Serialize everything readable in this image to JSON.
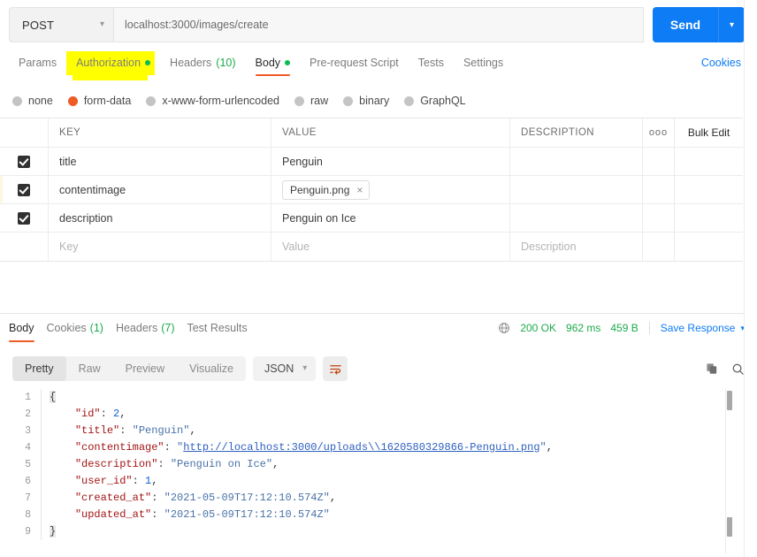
{
  "request": {
    "method": "POST",
    "method_caret": "chevron-down",
    "url": "localhost:3000/images/create",
    "send_label": "Send",
    "tabs": [
      {
        "label": "Params",
        "active": false,
        "dot": false,
        "count": ""
      },
      {
        "label": "Authorization",
        "active": false,
        "dot": true,
        "count": "",
        "highlighted": true
      },
      {
        "label": "Headers",
        "active": false,
        "dot": false,
        "count": "(10)"
      },
      {
        "label": "Body",
        "active": true,
        "dot": true,
        "count": ""
      },
      {
        "label": "Pre-request Script",
        "active": false,
        "dot": false,
        "count": ""
      },
      {
        "label": "Tests",
        "active": false,
        "dot": false,
        "count": ""
      },
      {
        "label": "Settings",
        "active": false,
        "dot": false,
        "count": ""
      }
    ],
    "cookies_link": "Cookies"
  },
  "body_types": [
    {
      "label": "none",
      "selected": false
    },
    {
      "label": "form-data",
      "selected": true
    },
    {
      "label": "x-www-form-urlencoded",
      "selected": false
    },
    {
      "label": "raw",
      "selected": false
    },
    {
      "label": "binary",
      "selected": false
    },
    {
      "label": "GraphQL",
      "selected": false
    }
  ],
  "form_table": {
    "headers": {
      "key": "KEY",
      "value": "VALUE",
      "description": "DESCRIPTION",
      "options": "ooo",
      "bulk_edit": "Bulk Edit"
    },
    "rows": [
      {
        "checked": true,
        "key": "title",
        "value": "Penguin",
        "description": "",
        "is_file": false
      },
      {
        "checked": true,
        "key": "contentimage",
        "value": "Penguin.png",
        "description": "",
        "is_file": true,
        "chip_close": "×"
      },
      {
        "checked": true,
        "key": "description",
        "value": "Penguin on Ice",
        "description": "",
        "is_file": false
      }
    ],
    "placeholder_row": {
      "key": "Key",
      "value": "Value",
      "description": "Description"
    }
  },
  "response": {
    "tabs": [
      {
        "label": "Body",
        "active": true,
        "count": ""
      },
      {
        "label": "Cookies",
        "active": false,
        "count": "(1)"
      },
      {
        "label": "Headers",
        "active": false,
        "count": "(7)"
      },
      {
        "label": "Test Results",
        "active": false,
        "count": ""
      }
    ],
    "status": "200 OK",
    "time": "962 ms",
    "size": "459 B",
    "save_response": "Save Response",
    "view_modes": [
      {
        "label": "Pretty",
        "active": true
      },
      {
        "label": "Raw",
        "active": false
      },
      {
        "label": "Preview",
        "active": false
      },
      {
        "label": "Visualize",
        "active": false
      }
    ],
    "format": "JSON",
    "icons": {
      "globe": "globe-icon",
      "wrap": "word-wrap-icon",
      "copy": "copy-icon",
      "search": "search-icon"
    },
    "code_lines": [
      {
        "n": "1",
        "tokens": [
          {
            "t": "{",
            "c": "brace"
          }
        ]
      },
      {
        "n": "2",
        "tokens": [
          {
            "t": "    ",
            "c": "p"
          },
          {
            "t": "\"id\"",
            "c": "k"
          },
          {
            "t": ": ",
            "c": "p"
          },
          {
            "t": "2",
            "c": "n"
          },
          {
            "t": ",",
            "c": "p"
          }
        ]
      },
      {
        "n": "3",
        "tokens": [
          {
            "t": "    ",
            "c": "p"
          },
          {
            "t": "\"title\"",
            "c": "k"
          },
          {
            "t": ": ",
            "c": "p"
          },
          {
            "t": "\"Penguin\"",
            "c": "s"
          },
          {
            "t": ",",
            "c": "p"
          }
        ]
      },
      {
        "n": "4",
        "tokens": [
          {
            "t": "    ",
            "c": "p"
          },
          {
            "t": "\"contentimage\"",
            "c": "k"
          },
          {
            "t": ": ",
            "c": "p"
          },
          {
            "t": "\"",
            "c": "s"
          },
          {
            "t": "http://localhost:3000/uploads\\\\1620580329866-Penguin.png",
            "c": "lnk"
          },
          {
            "t": "\"",
            "c": "s"
          },
          {
            "t": ",",
            "c": "p"
          }
        ]
      },
      {
        "n": "5",
        "tokens": [
          {
            "t": "    ",
            "c": "p"
          },
          {
            "t": "\"description\"",
            "c": "k"
          },
          {
            "t": ": ",
            "c": "p"
          },
          {
            "t": "\"Penguin on Ice\"",
            "c": "s"
          },
          {
            "t": ",",
            "c": "p"
          }
        ]
      },
      {
        "n": "6",
        "tokens": [
          {
            "t": "    ",
            "c": "p"
          },
          {
            "t": "\"user_id\"",
            "c": "k"
          },
          {
            "t": ": ",
            "c": "p"
          },
          {
            "t": "1",
            "c": "n"
          },
          {
            "t": ",",
            "c": "p"
          }
        ]
      },
      {
        "n": "7",
        "tokens": [
          {
            "t": "    ",
            "c": "p"
          },
          {
            "t": "\"created_at\"",
            "c": "k"
          },
          {
            "t": ": ",
            "c": "p"
          },
          {
            "t": "\"2021-05-09T17:12:10.574Z\"",
            "c": "s"
          },
          {
            "t": ",",
            "c": "p"
          }
        ]
      },
      {
        "n": "8",
        "tokens": [
          {
            "t": "    ",
            "c": "p"
          },
          {
            "t": "\"updated_at\"",
            "c": "k"
          },
          {
            "t": ": ",
            "c": "p"
          },
          {
            "t": "\"2021-05-09T17:12:10.574Z\"",
            "c": "s"
          }
        ]
      },
      {
        "n": "9",
        "tokens": [
          {
            "t": "}",
            "c": "brace"
          }
        ]
      }
    ]
  },
  "colors": {
    "accent_blue": "#0e7cf4",
    "accent_orange": "#ef5b25",
    "status_green": "#1bab4b",
    "highlight_yellow": "#ffff00"
  }
}
